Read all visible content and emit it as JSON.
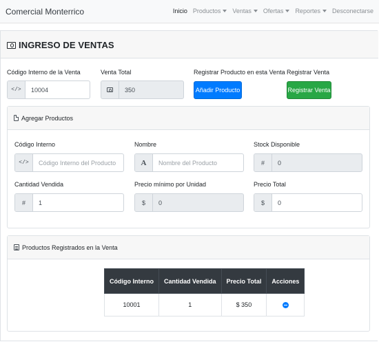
{
  "navbar": {
    "brand": "Comercial Monterrico",
    "items": [
      {
        "label": "Inicio",
        "dropdown": false,
        "active": true
      },
      {
        "label": "Productos",
        "dropdown": true,
        "active": false
      },
      {
        "label": "Ventas",
        "dropdown": true,
        "active": false
      },
      {
        "label": "Ofertas",
        "dropdown": true,
        "active": false
      },
      {
        "label": "Reportes",
        "dropdown": true,
        "active": false
      },
      {
        "label": "Desconectarse",
        "dropdown": false,
        "active": false
      }
    ]
  },
  "page": {
    "title": "INGRESO DE VENTAS"
  },
  "sale": {
    "code_label": "Código Interno de la Venta",
    "code_value": "10004",
    "total_label": "Venta Total",
    "total_value": "350",
    "register_product_label": "Registrar Producto en esta Venta",
    "add_product_button": "Añadir Producto",
    "register_sale_label": "Registrar Venta",
    "register_sale_button": "Registrar Venta"
  },
  "add_products": {
    "header": "Agregar Productos",
    "code_label": "Código Interno",
    "code_placeholder": "Código Interno del Producto",
    "name_label": "Nombre",
    "name_placeholder": "Nombre del Producto",
    "stock_label": "Stock Disponible",
    "stock_value": "0",
    "qty_label": "Cantidad Vendida",
    "qty_value": "1",
    "min_price_label": "Precio mínimo por Unidad",
    "min_price_value": "0",
    "total_price_label": "Precio Total",
    "total_price_value": "0"
  },
  "registered": {
    "header": "Productos Registrados en la Venta",
    "columns": [
      "Código Interno",
      "Cantidad Vendida",
      "Precio Total",
      "Acciones"
    ],
    "rows": [
      {
        "code": "10001",
        "qty": "1",
        "total": "$ 350"
      }
    ]
  },
  "icons": {
    "code_addon": "</>",
    "hash_addon": "#",
    "dollar_addon": "$",
    "name_addon": "A"
  },
  "colors": {
    "primary": "#007bff",
    "success": "#28a745",
    "table_header": "#343a40"
  }
}
